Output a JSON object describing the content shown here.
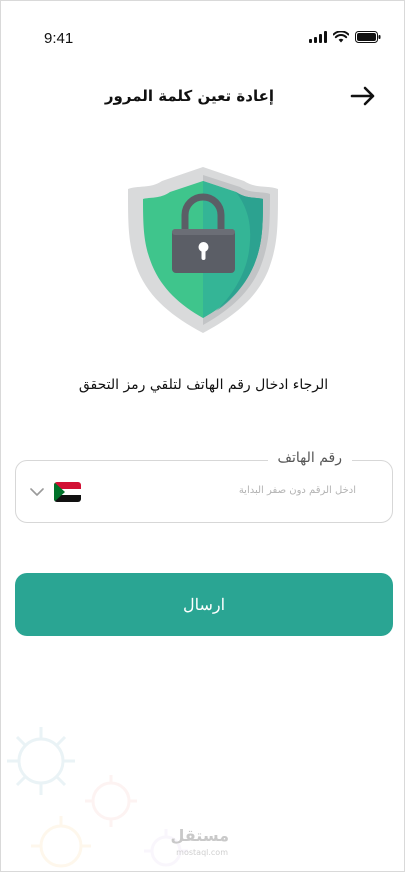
{
  "status_bar": {
    "time": "9:41"
  },
  "header": {
    "title": "إعادة تعين كلمة المرور"
  },
  "illustration": {
    "icon": "shield-lock"
  },
  "instruction": "الرجاء ادخال رقم الهاتف لتلقي رمز التحقق",
  "phone_field": {
    "label": "رقم الهاتف",
    "placeholder": "ادخل الرقم دون صفر البداية",
    "country": "sudan-flag"
  },
  "submit_button": {
    "label": "ارسال"
  },
  "watermark": {
    "brand": "مستقل",
    "url": "mostaql.com"
  },
  "colors": {
    "accent": "#2aa593",
    "shield_green": "#3fc58c",
    "shield_teal": "#2aa593",
    "lock": "#5b5e66"
  }
}
